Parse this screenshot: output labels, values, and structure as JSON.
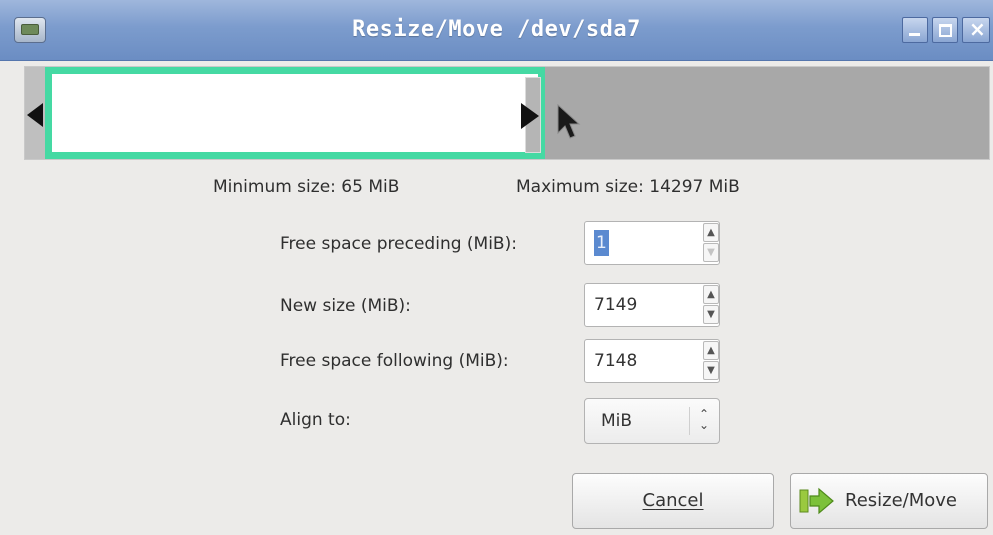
{
  "window": {
    "title": "Resize/Move /dev/sda7",
    "icon": "gparted-app-icon",
    "controls": [
      "minimize-icon",
      "maximize-icon",
      "close-icon"
    ]
  },
  "partition_graphic": {
    "partition_color": "#45d9a3",
    "unallocated_color": "#a8a8a8"
  },
  "limits": {
    "minimum": "Minimum size: 65 MiB",
    "maximum": "Maximum size: 14297 MiB"
  },
  "fields": {
    "free_preceding": {
      "label": "Free space preceding (MiB):",
      "value": "1"
    },
    "new_size": {
      "label": "New size (MiB):",
      "value": "7149"
    },
    "free_following": {
      "label": "Free space following (MiB):",
      "value": "7148"
    },
    "align": {
      "label": "Align to:",
      "value": "MiB"
    }
  },
  "buttons": {
    "cancel": "Cancel",
    "resize_move": "Resize/Move"
  }
}
